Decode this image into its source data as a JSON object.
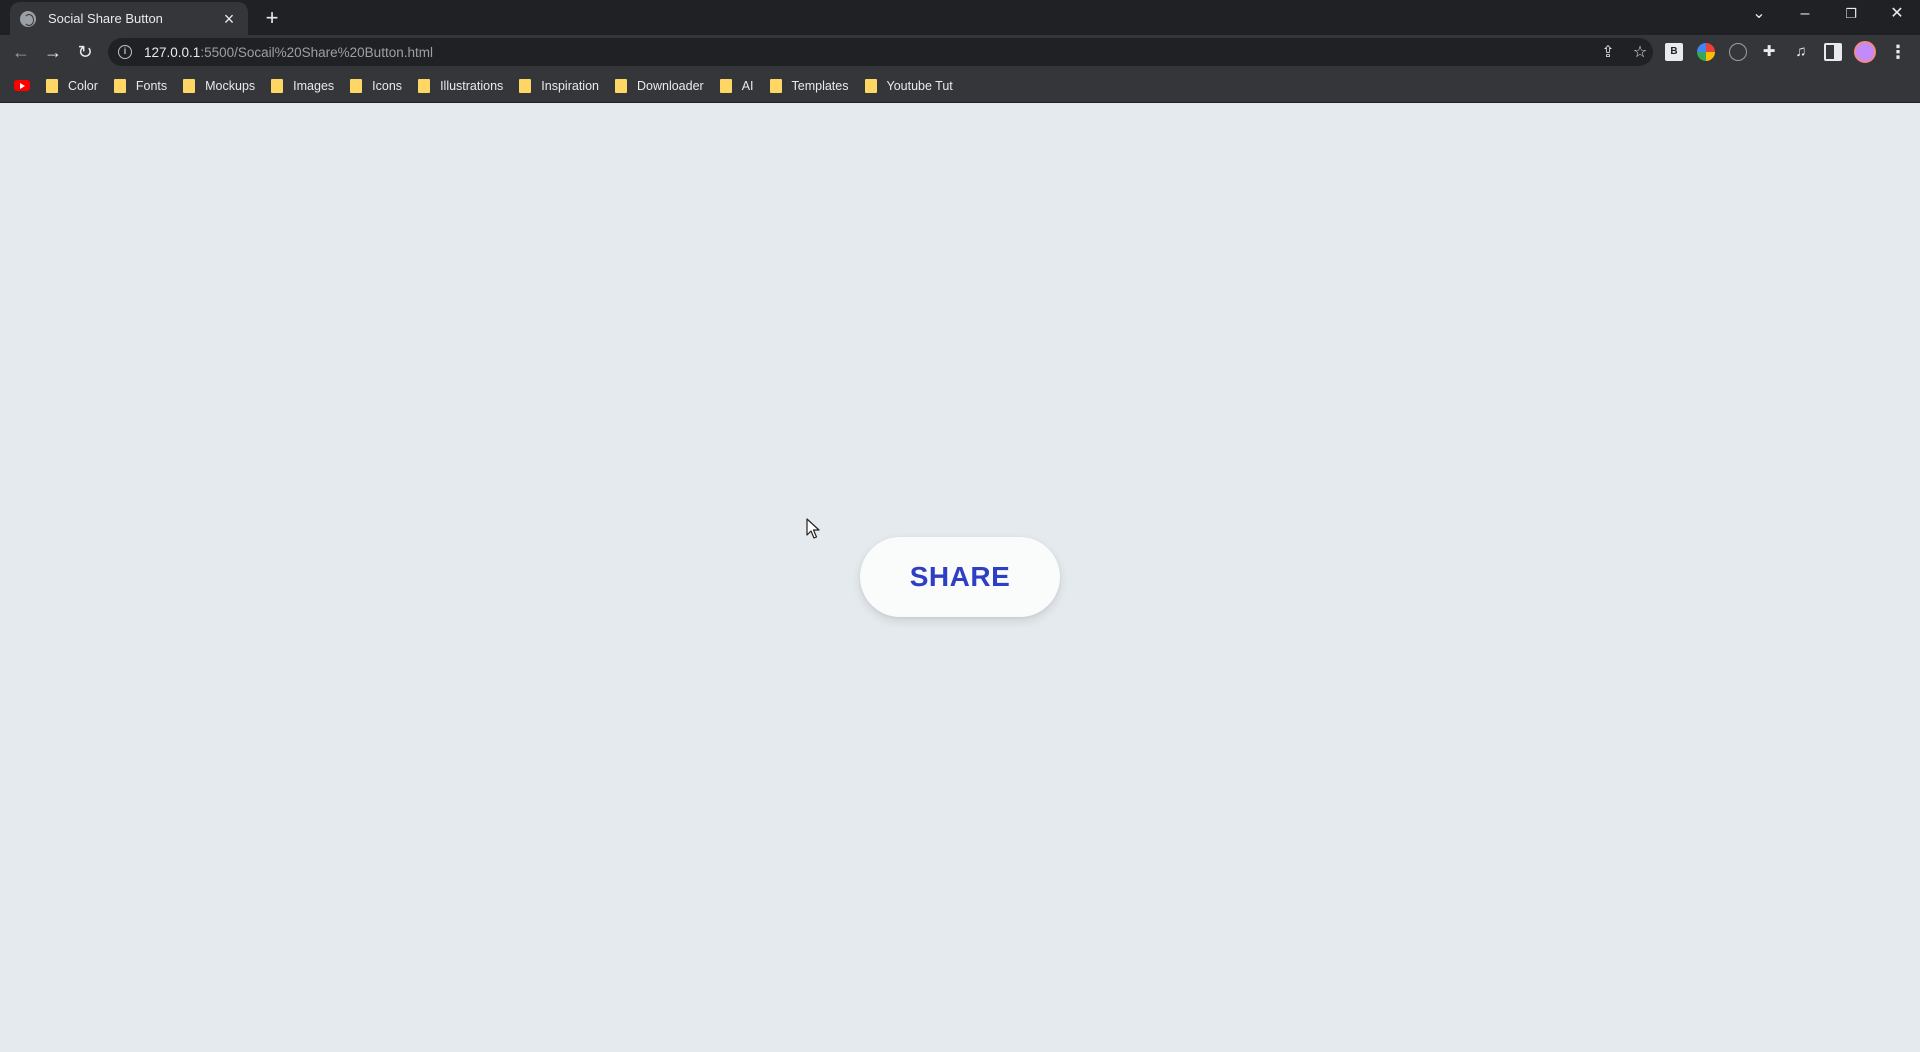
{
  "browser": {
    "tab": {
      "title": "Social Share Button"
    },
    "new_tab_symbol": "+",
    "address": {
      "host": "127.0.0.1",
      "rest": ":5500/Socail%20Share%20Button.html"
    },
    "bookmarks": [
      {
        "label": "Color"
      },
      {
        "label": "Fonts"
      },
      {
        "label": "Mockups"
      },
      {
        "label": "Images"
      },
      {
        "label": "Icons"
      },
      {
        "label": "Illustrations"
      },
      {
        "label": "Inspiration"
      },
      {
        "label": "Downloader"
      },
      {
        "label": "AI"
      },
      {
        "label": "Templates"
      },
      {
        "label": "Youtube Tut"
      }
    ],
    "extension_b_label": "B",
    "icons": {
      "back": "back-arrow-icon",
      "forward": "forward-arrow-icon",
      "reload": "reload-icon",
      "share": "share-page-icon",
      "bookmark": "star-icon",
      "extensions": "puzzle-icon",
      "media": "media-control-icon",
      "side_panel": "side-panel-icon",
      "menu": "kebab-menu-icon"
    }
  },
  "page": {
    "share_button": {
      "label": "SHARE",
      "text_color": "#2f3fc4",
      "background": "#fafbfb"
    },
    "background_color": "#e4eaed"
  }
}
